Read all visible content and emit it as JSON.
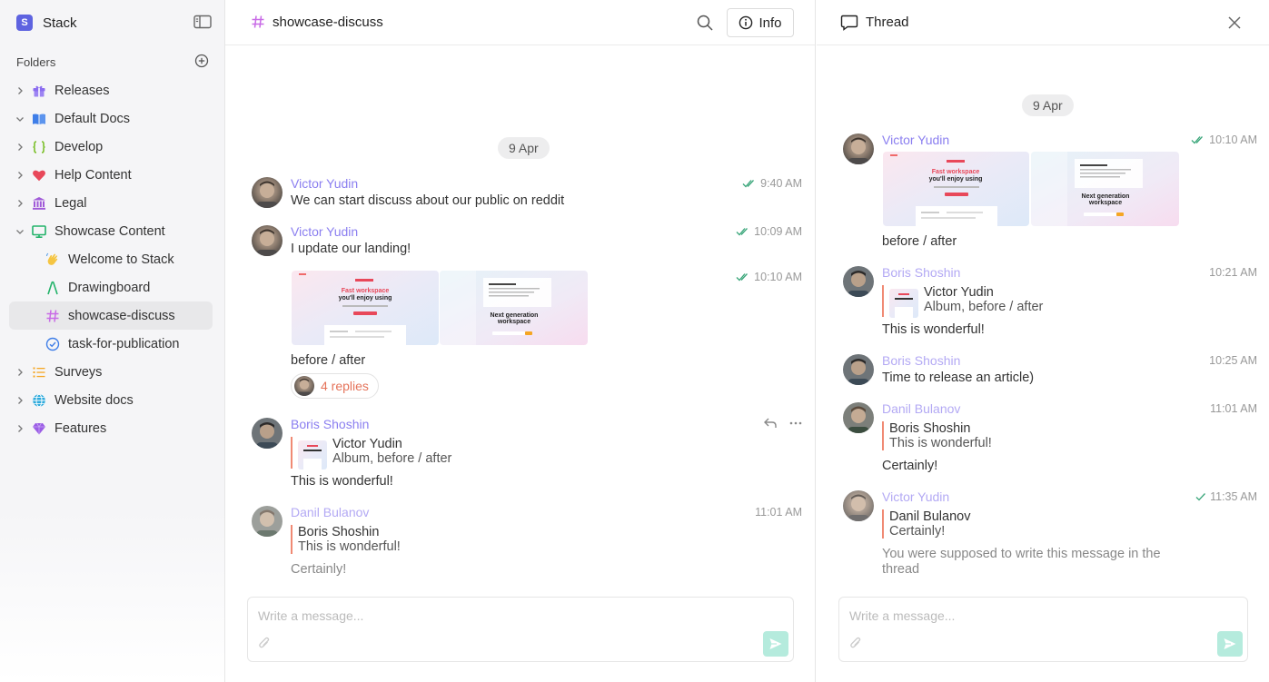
{
  "workspace": {
    "logo_letter": "S",
    "name": "Stack"
  },
  "sidebar": {
    "folders_label": "Folders",
    "items": [
      {
        "label": "Releases",
        "icon": "gift-icon",
        "color": "#8b6cf0",
        "expanded": false
      },
      {
        "label": "Default Docs",
        "icon": "book-icon",
        "color": "#3f7ee8",
        "expanded": true
      },
      {
        "label": "Develop",
        "icon": "braces-icon",
        "color": "#7cc02c",
        "expanded": false
      },
      {
        "label": "Help Content",
        "icon": "heart-icon",
        "color": "#e8485a",
        "expanded": false
      },
      {
        "label": "Legal",
        "icon": "bank-icon",
        "color": "#a05ad8",
        "expanded": false
      },
      {
        "label": "Showcase Content",
        "icon": "monitor-icon",
        "color": "#23b36a",
        "expanded": true
      },
      {
        "label": "Welcome to Stack",
        "icon": "wave-hand-icon",
        "color": "#f5c542",
        "child": true
      },
      {
        "label": "Drawingboard",
        "icon": "pen-icon",
        "color": "#23b36a",
        "child": true
      },
      {
        "label": "showcase-discuss",
        "icon": "hash-icon",
        "color": "#c86be6",
        "child": true,
        "active": true
      },
      {
        "label": "task-for-publication",
        "icon": "check-circle-icon",
        "color": "#3f7ee8",
        "child": true
      },
      {
        "label": "Surveys",
        "icon": "list-icon",
        "color": "#f5a623",
        "expanded": false
      },
      {
        "label": "Website docs",
        "icon": "globe-icon",
        "color": "#2eaadc",
        "expanded": false
      },
      {
        "label": "Features",
        "icon": "diamond-icon",
        "color": "#9b5de5",
        "expanded": false
      }
    ]
  },
  "channel": {
    "title": "showcase-discuss",
    "info_label": "Info",
    "date": "9 Apr",
    "messages": [
      {
        "author": "Victor Yudin",
        "text": "We can start discuss about our public on reddit",
        "time": "9:40 AM"
      },
      {
        "author": "Victor Yudin",
        "text": "I update our landing!",
        "time": "10:09 AM"
      },
      {
        "time": "10:10 AM",
        "caption": "before / after",
        "replies": "4 replies"
      },
      {
        "author": "Boris Shoshin",
        "quote_name": "Victor Yudin",
        "quote_text": "Album, before / after",
        "text": "This is wonderful!"
      },
      {
        "author": "Danil Bulanov",
        "time": "11:01 AM",
        "quote_name": "Boris Shoshin",
        "quote_text": "This is wonderful!",
        "text": "Certainly!"
      }
    ],
    "composer_placeholder": "Write a message..."
  },
  "thumbs": {
    "a_line1": "Fast workspace",
    "a_line2": "you'll enjoy using",
    "b_line1": "Next generation",
    "b_line2": "workspace"
  },
  "thread": {
    "title": "Thread",
    "date": "9 Apr",
    "messages": [
      {
        "author": "Victor Yudin",
        "time": "10:10 AM",
        "caption": "before / after"
      },
      {
        "author": "Boris Shoshin",
        "time": "10:21 AM",
        "quote_name": "Victor Yudin",
        "quote_text": "Album, before / after",
        "text": "This is wonderful!"
      },
      {
        "author": "Boris Shoshin",
        "time": "10:25 AM",
        "text": "Time to release an article)"
      },
      {
        "author": "Danil Bulanov",
        "time": "11:01 AM",
        "quote_name": "Boris Shoshin",
        "quote_text": "This is wonderful!",
        "text": "Certainly!"
      },
      {
        "author": "Victor Yudin",
        "time": "11:35 AM",
        "quote_name": "Danil Bulanov",
        "quote_text": "Certainly!",
        "text_line1": "You were supposed to write this message in the",
        "text_line2": "thread"
      }
    ],
    "composer_placeholder": "Write a message..."
  },
  "colors": {
    "accent": "#8b7ff0",
    "quote_bar": "#f08a74",
    "send": "#b5ebdd",
    "replies": "#e5735a",
    "check": "#3aa67a"
  }
}
